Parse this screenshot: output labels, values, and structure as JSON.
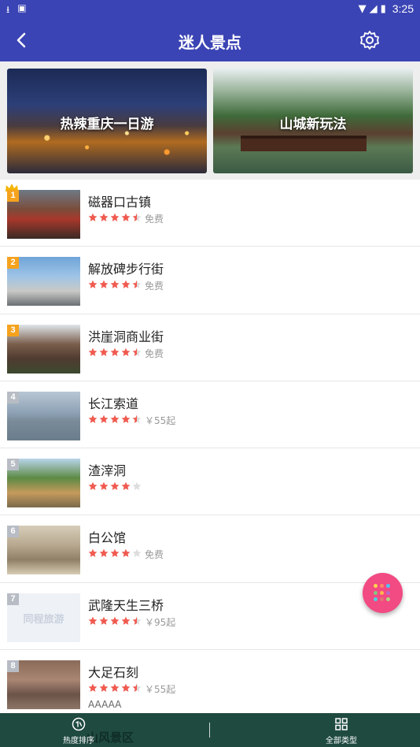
{
  "statusbar": {
    "left_icons": [
      "download-icon",
      "image-icon"
    ],
    "time": "3:25"
  },
  "appbar": {
    "title": "迷人景点"
  },
  "banners": [
    {
      "label": "热辣重庆一日游"
    },
    {
      "label": "山城新玩法"
    }
  ],
  "list": {
    "items": [
      {
        "rank": "1",
        "name": "磁器口古镇",
        "rating": 4.5,
        "price": "免费"
      },
      {
        "rank": "2",
        "name": "解放碑步行街",
        "rating": 4.5,
        "price": "免费"
      },
      {
        "rank": "3",
        "name": "洪崖洞商业街",
        "rating": 4.5,
        "price": "免费"
      },
      {
        "rank": "4",
        "name": "长江索道",
        "rating": 4.5,
        "price": "￥55起"
      },
      {
        "rank": "5",
        "name": "渣滓洞",
        "rating": 4,
        "price": ""
      },
      {
        "rank": "6",
        "name": "白公馆",
        "rating": 4,
        "price": "免费"
      },
      {
        "rank": "7",
        "name": "武隆天生三桥",
        "rating": 4.5,
        "price": "￥95起",
        "placeholder": "同程旅游"
      },
      {
        "rank": "8",
        "name": "大足石刻",
        "rating": 4.5,
        "price": "￥55起",
        "extra": "AAAAA"
      }
    ]
  },
  "bottom_ghost": "山风景区",
  "tabs": {
    "hot": "热度排序",
    "all": "全部类型"
  },
  "colors": {
    "primary": "#3b44b4",
    "star": "#f05a4f",
    "star_empty": "#dddddd",
    "fab": "#f24a83",
    "bottom_bar": "#1f4a40"
  }
}
